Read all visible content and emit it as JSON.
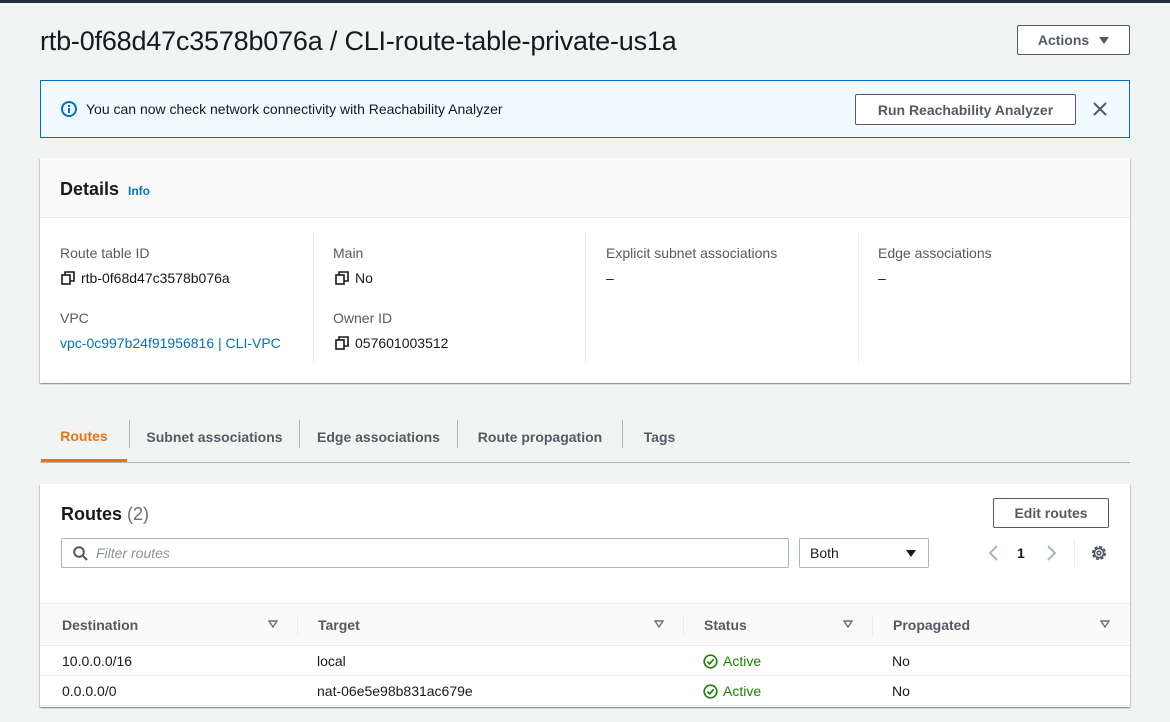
{
  "page": {
    "title": "rtb-0f68d47c3578b076a / CLI-route-table-private-us1a",
    "actions_label": "Actions"
  },
  "flash": {
    "message": "You can now check network connectivity with Reachability Analyzer",
    "button_label": "Run Reachability Analyzer"
  },
  "details": {
    "title": "Details",
    "info_link": "Info",
    "fields": {
      "route_table_id": {
        "label": "Route table ID",
        "value": "rtb-0f68d47c3578b076a"
      },
      "vpc": {
        "label": "VPC",
        "value": "vpc-0c997b24f91956816 | CLI-VPC"
      },
      "main": {
        "label": "Main",
        "value": "No"
      },
      "owner_id": {
        "label": "Owner ID",
        "value": "057601003512"
      },
      "explicit_subnet": {
        "label": "Explicit subnet associations",
        "value": "–"
      },
      "edge": {
        "label": "Edge associations",
        "value": "–"
      }
    }
  },
  "tabs": [
    {
      "label": "Routes",
      "active": true
    },
    {
      "label": "Subnet associations",
      "active": false
    },
    {
      "label": "Edge associations",
      "active": false
    },
    {
      "label": "Route propagation",
      "active": false
    },
    {
      "label": "Tags",
      "active": false
    }
  ],
  "routes": {
    "title": "Routes",
    "count": "(2)",
    "edit_label": "Edit routes",
    "filter_placeholder": "Filter routes",
    "select_value": "Both",
    "page": "1",
    "columns": [
      "Destination",
      "Target",
      "Status",
      "Propagated"
    ],
    "rows": [
      {
        "destination": "10.0.0.0/16",
        "target": "local",
        "target_is_link": false,
        "status": "Active",
        "propagated": "No"
      },
      {
        "destination": "0.0.0.0/0",
        "target": "nat-06e5e98b831ac679e",
        "target_is_link": true,
        "status": "Active",
        "propagated": "No"
      }
    ]
  },
  "colors": {
    "accent": "#ec7211",
    "link": "#0073bb",
    "success": "#1d8102",
    "flash_bg": "#f1faff"
  },
  "icons": {
    "info": "info-icon",
    "close": "close-icon",
    "copy": "copy-icon",
    "search": "search-icon",
    "settings": "gear-icon",
    "sort": "sort-down-icon",
    "status_ok": "check-circle-icon",
    "pager_prev": "chevron-left-icon",
    "pager_next": "chevron-right-icon",
    "dropdown": "caret-down-icon"
  }
}
